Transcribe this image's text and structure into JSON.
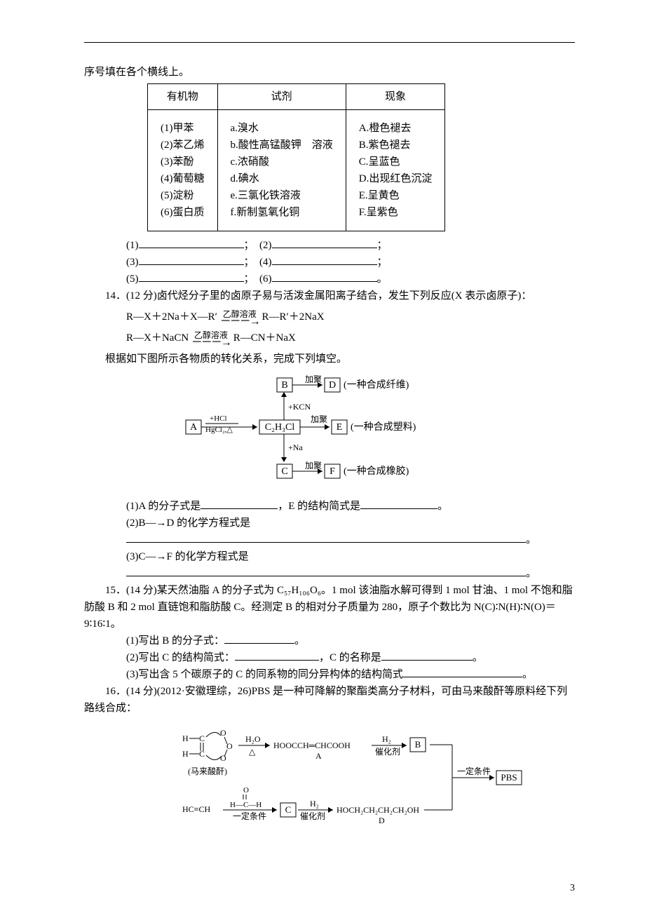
{
  "intro_line": "序号填在各个横线上。",
  "table": {
    "headers": [
      "有机物",
      "试剂",
      "现象"
    ],
    "col1": [
      "(1)甲苯",
      "(2)苯乙烯",
      "(3)苯酚",
      "(4)葡萄糖",
      "(5)淀粉",
      "(6)蛋白质"
    ],
    "col2": [
      "a.溴水",
      "b.酸性高锰酸钾　溶液",
      "c.浓硝酸",
      "d.碘水",
      "e.三氯化铁溶液",
      "f.新制氢氧化铜"
    ],
    "col3": [
      "A.橙色褪去",
      "B.紫色褪去",
      "C.呈蓝色",
      "D.出现红色沉淀",
      "E.呈黄色",
      "F.呈紫色"
    ]
  },
  "blanks_line1_a": "(1)",
  "blanks_line1_b": "；　(2)",
  "blanks_line1_c": "；",
  "blanks_line2_a": "(3)",
  "blanks_line2_b": "；　(4)",
  "blanks_line2_c": "；",
  "blanks_line3_a": "(5)",
  "blanks_line3_b": "；　(6)",
  "blanks_line3_c": "。",
  "q14_lead": "14．(12 分)卤代烃分子里的卤原子易与活泼金属阳离子结合，发生下列反应(X 表示卤原子)：",
  "q14_eq1_left": "R—X＋2Na＋X—R′",
  "q14_arrow_label": "乙醇溶液",
  "q14_eq1_right": "R—R′＋2NaX",
  "q14_eq2_left": "R—X＋NaCN",
  "q14_eq2_right": "R—CN＋NaX",
  "q14_bridge": "根据如下图所示各物质的转化关系，完成下列填空。",
  "diagram14": {
    "B": "B",
    "D": "D",
    "A": "A",
    "E": "E",
    "C": "C",
    "F": "F",
    "c2h3cl": "C₂H₃Cl",
    "add_KCN": "+KCN",
    "add_Na": "+Na",
    "add_HCl": "+HCl",
    "HgCl2": "HgCl₂,△",
    "jiaju": "加聚",
    "fiber": "(一种合成纤维)",
    "plastic": "(一种合成塑料)",
    "rubber": "(一种合成橡胶)"
  },
  "q14_1a": "(1)A 的分子式是",
  "q14_1b": "，E 的结构简式是",
  "q14_1c": "。",
  "q14_2": "(2)B―→D 的化学方程式是",
  "q14_3": "(3)C―→F 的化学方程式是",
  "full_stop": "。",
  "q15_lead": "15．(14 分)某天然油脂 A 的分子式为 C₅₇H₁₀₆O₆。1 mol 该油脂水解可得到 1 mol 甘油、1 mol 不饱和脂肪酸 B 和 2 mol 直链饱和脂肪酸 C。经测定 B 的相对分子质量为 280，原子个数比为 N(C)∶N(H)∶N(O)＝9∶16∶1。",
  "q15_1a": "(1)写出 B 的分子式：",
  "q15_1b": "。",
  "q15_2a": "(2)写出 C 的结构简式：",
  "q15_2b": "，C 的名称是",
  "q15_2c": "。",
  "q15_3a": "(3)写出含 5 个碳原子的 C 的同系物的同分异构体的结构简式",
  "q15_3b": "。",
  "q16_lead": "16．(14 分)(2012·安徽理综，26)PBS 是一种可降解的聚酯类高分子材料，可由马来酸酐等原料经下列路线合成：",
  "scheme16": {
    "maleic": "(马来酸酐)",
    "h2o": "H₂O",
    "delta": "△",
    "A": "A",
    "A_formula": "HOOCCH═CHCOOH",
    "h2": "H₂",
    "catalyst": "催化剂",
    "B": "B",
    "cond": "一定条件",
    "PBS": "PBS",
    "alkyne": "HC≡CH",
    "HCHO_top": "O",
    "HCHO_mid": "H—C—H",
    "C": "C",
    "D": "D",
    "D_formula": "HOCH₂CH₂CH₂CH₂OH"
  },
  "pagenum": "3"
}
